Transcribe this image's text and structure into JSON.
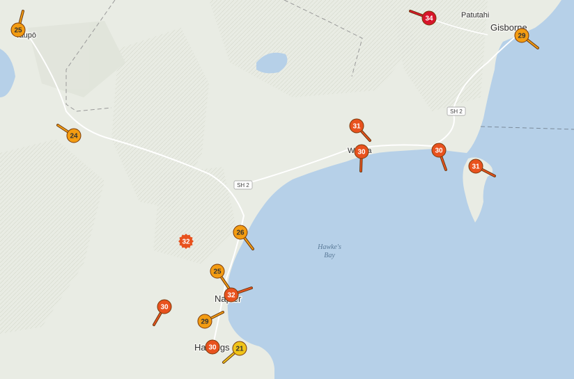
{
  "map": {
    "places": [
      {
        "id": "taupo",
        "label": "Taupō"
      },
      {
        "id": "patutahi",
        "label": "Patutahi"
      },
      {
        "id": "gisborne",
        "label": "Gisborne"
      },
      {
        "id": "wairoa",
        "label": "Wairoa"
      },
      {
        "id": "napier",
        "label": "Napier"
      },
      {
        "id": "hastings",
        "label": "Hastings"
      }
    ],
    "water_label": "Hawke's Bay",
    "roads": [
      {
        "id": "sh2-north",
        "label": "SH 2"
      },
      {
        "id": "sh2-south",
        "label": "SH 2"
      }
    ],
    "colors": {
      "sea": "#b6d0e8",
      "land": "#e9ece4",
      "temp_21": "#f0c419",
      "temp_24_29": "#f39c12",
      "temp_30_32": "#e8521e",
      "temp_34": "#d7152b"
    },
    "stations": [
      {
        "id": "taupo",
        "value": "25",
        "color": "#f39c12"
      },
      {
        "id": "taihape-north",
        "value": "24",
        "color": "#f39c12"
      },
      {
        "id": "matawai",
        "value": "34",
        "color": "#d7152b"
      },
      {
        "id": "gisborne",
        "value": "29",
        "color": "#f39c12"
      },
      {
        "id": "wairoa-north",
        "value": "31",
        "color": "#e8521e"
      },
      {
        "id": "wairoa",
        "value": "30",
        "color": "#e8521e"
      },
      {
        "id": "nuhaka",
        "value": "30",
        "color": "#e8521e"
      },
      {
        "id": "mahia",
        "value": "31",
        "color": "#e8521e"
      },
      {
        "id": "inland-hawkes-bay",
        "value": "32",
        "color": "#e8521e"
      },
      {
        "id": "tangoio",
        "value": "26",
        "color": "#f39c12"
      },
      {
        "id": "napier-north",
        "value": "25",
        "color": "#f39c12"
      },
      {
        "id": "napier",
        "value": "32",
        "color": "#e8521e"
      },
      {
        "id": "maraekakaho",
        "value": "30",
        "color": "#e8521e"
      },
      {
        "id": "hastings-west",
        "value": "29",
        "color": "#f39c12"
      },
      {
        "id": "hastings",
        "value": "30",
        "color": "#e8521e"
      },
      {
        "id": "cape-kidnappers",
        "value": "21",
        "color": "#f0c419"
      }
    ]
  }
}
